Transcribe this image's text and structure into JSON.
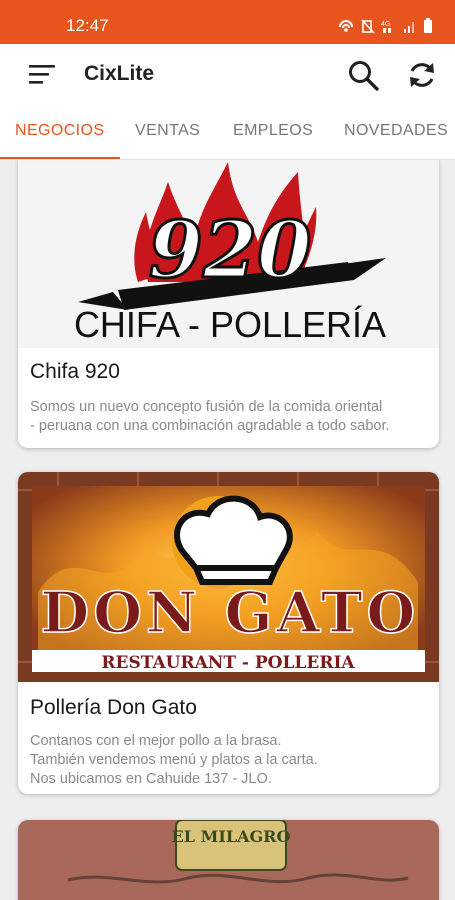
{
  "status_bar": {
    "time": "12:47"
  },
  "app_bar": {
    "title": "CixLite"
  },
  "tabs": [
    {
      "label": "NEGOCIOS",
      "active": true
    },
    {
      "label": "VENTAS",
      "active": false
    },
    {
      "label": "EMPLEOS",
      "active": false
    },
    {
      "label": "NOVEDADES",
      "active": false
    }
  ],
  "cards": [
    {
      "logo_number": "920",
      "logo_text": "CHIFA - POLLERÍA",
      "title": "Chifa 920",
      "description": [
        "Somos un nuevo concepto fusión de la comida oriental",
        "- peruana con una combinación agradable a todo sabor."
      ]
    },
    {
      "logo_text": "DON GATO",
      "logo_subtext": "RESTAURANT - POLLERIA",
      "title": "Pollería Don Gato",
      "description": [
        "Contanos con el mejor pollo a la brasa.",
        "También vendemos menú y platos a la carta.",
        "Nos ubicamos en Cahuide 137 - JLO."
      ]
    },
    {
      "logo_text": "EL MILAGRO"
    }
  ],
  "colors": {
    "accent": "#e8541d"
  },
  "icons": [
    "menu-icon",
    "search-icon",
    "refresh-icon",
    "wifi-icon",
    "signal-icon",
    "battery-icon"
  ]
}
